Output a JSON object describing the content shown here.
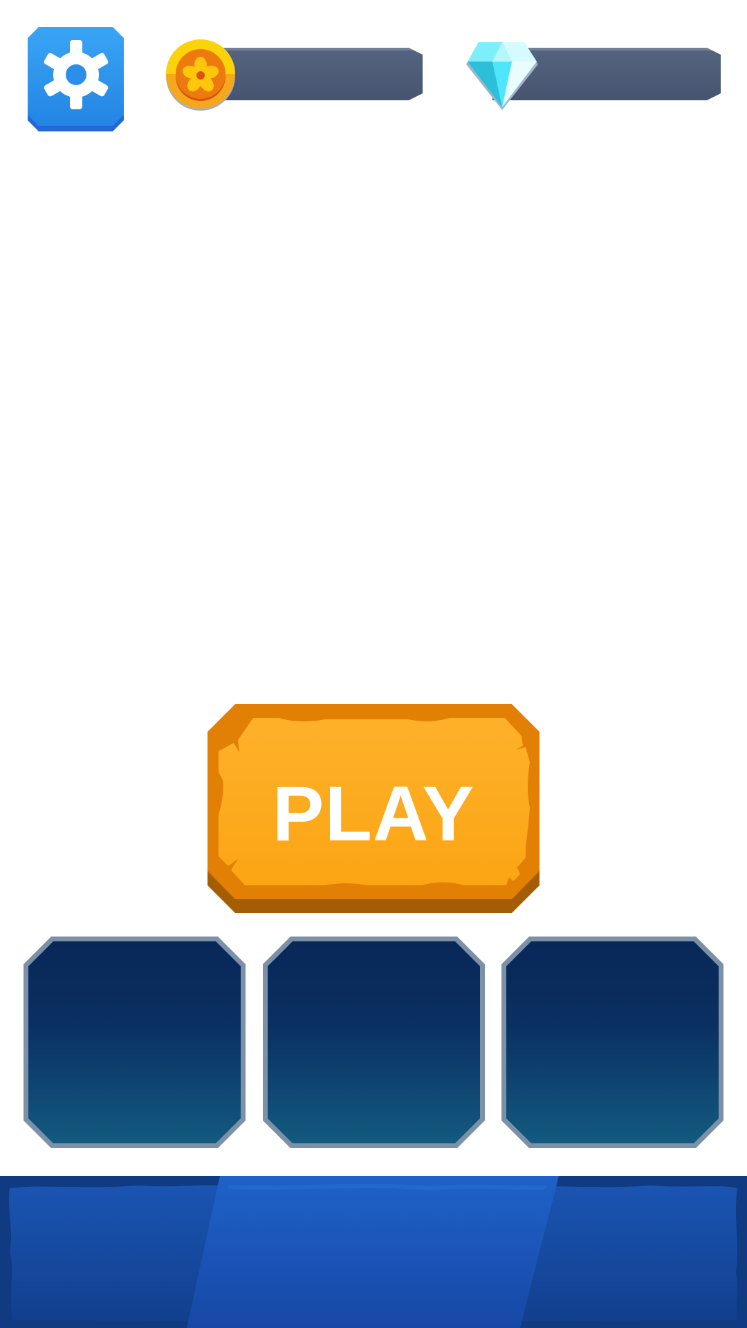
{
  "header": {
    "settings_icon": "gear-icon",
    "coin_icon": "coin-flower-icon",
    "gem_icon": "diamond-icon",
    "coins": "",
    "gems": ""
  },
  "play_button": {
    "label": "PLAY"
  },
  "slots": [
    {
      "label": ""
    },
    {
      "label": ""
    },
    {
      "label": ""
    }
  ],
  "bottom_nav": {
    "tabs": [
      {
        "label": ""
      },
      {
        "label": ""
      },
      {
        "label": ""
      }
    ]
  },
  "colors": {
    "background": "#ffffff",
    "settings_blue": "#2b93ec",
    "play_orange": "#fda91d",
    "play_border": "#e07e05",
    "slot_navy": "#0a2a5c",
    "slot_teal": "#135479",
    "nav_blue": "#1b4fae",
    "nav_dark": "#0f3c8c"
  }
}
